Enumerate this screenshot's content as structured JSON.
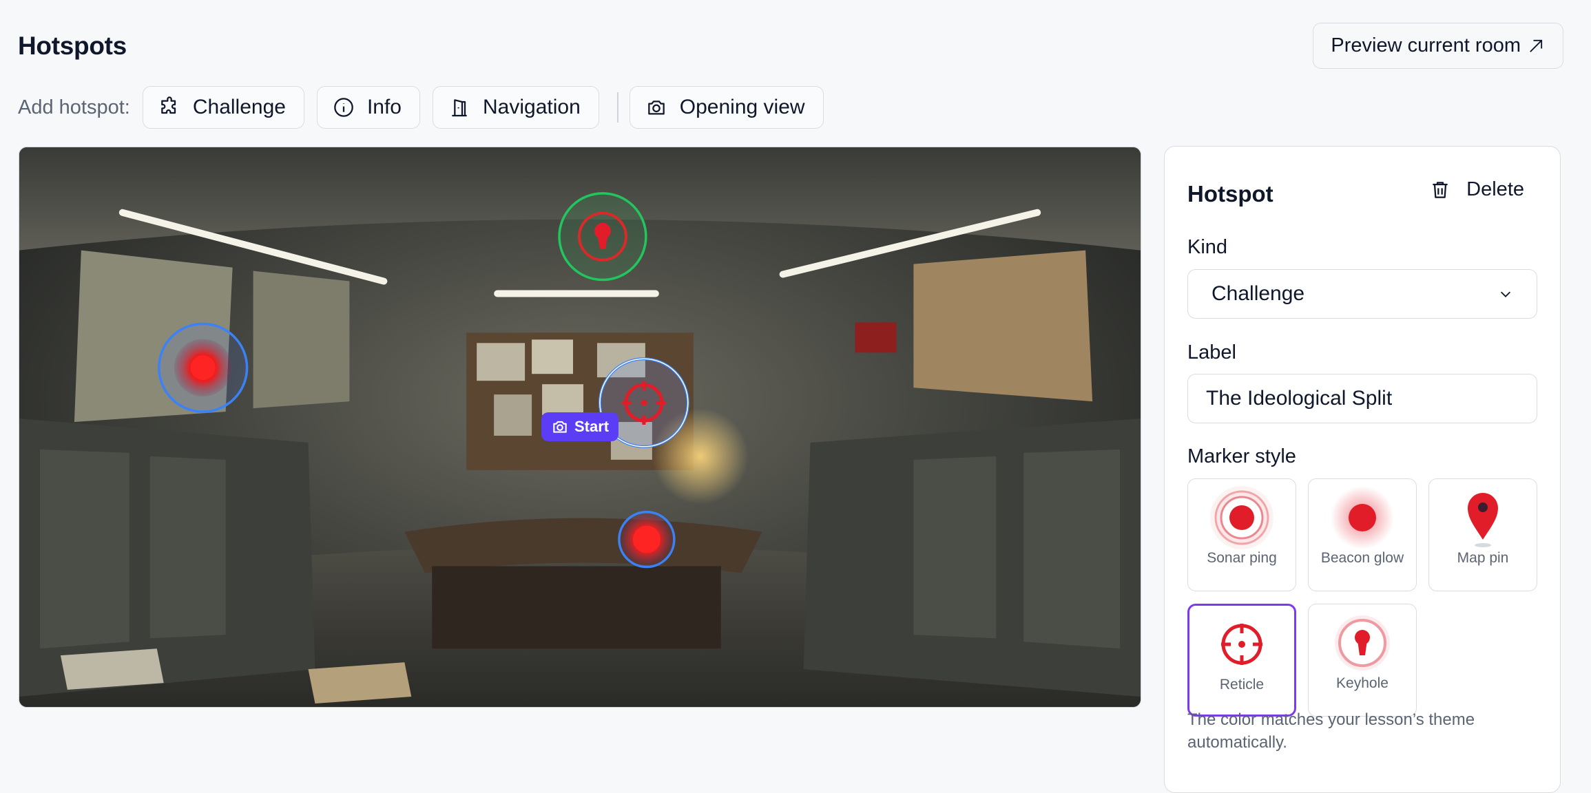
{
  "header": {
    "title": "Hotspots",
    "preview_label": "Preview current room"
  },
  "toolbar": {
    "label": "Add hotspot:",
    "buttons": [
      {
        "label": "Challenge",
        "icon": "puzzle-icon"
      },
      {
        "label": "Info",
        "icon": "info-icon"
      },
      {
        "label": "Navigation",
        "icon": "door-icon"
      },
      {
        "label": "Opening view",
        "icon": "camera-icon"
      }
    ]
  },
  "panorama": {
    "start_chip": "Start",
    "hotspots": [
      {
        "kind": "Challenge",
        "marker": "Keyhole",
        "ring_color": "#22c55e"
      },
      {
        "kind": "Info",
        "marker": "Beacon glow",
        "ring_color": "#3b82f6"
      },
      {
        "kind": "Challenge",
        "marker": "Reticle",
        "ring_color": "#3b82f6",
        "selected": true
      },
      {
        "kind": "Info",
        "marker": "Beacon glow",
        "ring_color": "#3b82f6"
      }
    ]
  },
  "panel": {
    "title": "Hotspot",
    "delete_label": "Delete",
    "kind_label": "Kind",
    "kind_value": "Challenge",
    "label_label": "Label",
    "label_value": "The Ideological Split",
    "marker_label": "Marker style",
    "markers": [
      {
        "name": "Sonar ping",
        "selected": false
      },
      {
        "name": "Beacon glow",
        "selected": false
      },
      {
        "name": "Map pin",
        "selected": false
      },
      {
        "name": "Reticle",
        "selected": true
      },
      {
        "name": "Keyhole",
        "selected": false
      }
    ],
    "hint": "The color matches your lesson’s theme automatically."
  },
  "colors": {
    "accent": "#7c3aed",
    "marker_red": "#e11d2a",
    "start_chip": "#5b3df5"
  }
}
